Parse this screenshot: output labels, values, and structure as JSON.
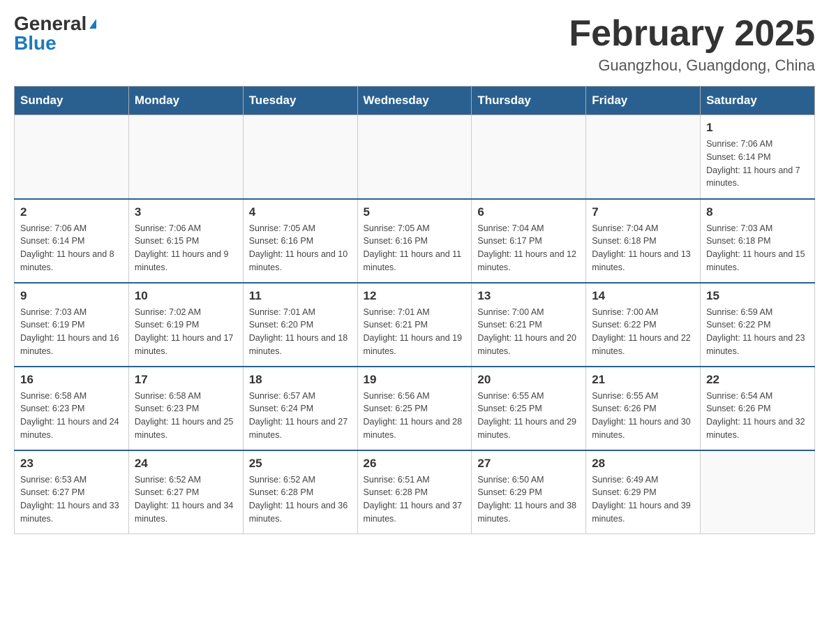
{
  "header": {
    "logo_general": "General",
    "logo_blue": "Blue",
    "month_title": "February 2025",
    "subtitle": "Guangzhou, Guangdong, China"
  },
  "days_of_week": [
    "Sunday",
    "Monday",
    "Tuesday",
    "Wednesday",
    "Thursday",
    "Friday",
    "Saturday"
  ],
  "weeks": [
    [
      {
        "day": "",
        "info": ""
      },
      {
        "day": "",
        "info": ""
      },
      {
        "day": "",
        "info": ""
      },
      {
        "day": "",
        "info": ""
      },
      {
        "day": "",
        "info": ""
      },
      {
        "day": "",
        "info": ""
      },
      {
        "day": "1",
        "info": "Sunrise: 7:06 AM\nSunset: 6:14 PM\nDaylight: 11 hours and 7 minutes."
      }
    ],
    [
      {
        "day": "2",
        "info": "Sunrise: 7:06 AM\nSunset: 6:14 PM\nDaylight: 11 hours and 8 minutes."
      },
      {
        "day": "3",
        "info": "Sunrise: 7:06 AM\nSunset: 6:15 PM\nDaylight: 11 hours and 9 minutes."
      },
      {
        "day": "4",
        "info": "Sunrise: 7:05 AM\nSunset: 6:16 PM\nDaylight: 11 hours and 10 minutes."
      },
      {
        "day": "5",
        "info": "Sunrise: 7:05 AM\nSunset: 6:16 PM\nDaylight: 11 hours and 11 minutes."
      },
      {
        "day": "6",
        "info": "Sunrise: 7:04 AM\nSunset: 6:17 PM\nDaylight: 11 hours and 12 minutes."
      },
      {
        "day": "7",
        "info": "Sunrise: 7:04 AM\nSunset: 6:18 PM\nDaylight: 11 hours and 13 minutes."
      },
      {
        "day": "8",
        "info": "Sunrise: 7:03 AM\nSunset: 6:18 PM\nDaylight: 11 hours and 15 minutes."
      }
    ],
    [
      {
        "day": "9",
        "info": "Sunrise: 7:03 AM\nSunset: 6:19 PM\nDaylight: 11 hours and 16 minutes."
      },
      {
        "day": "10",
        "info": "Sunrise: 7:02 AM\nSunset: 6:19 PM\nDaylight: 11 hours and 17 minutes."
      },
      {
        "day": "11",
        "info": "Sunrise: 7:01 AM\nSunset: 6:20 PM\nDaylight: 11 hours and 18 minutes."
      },
      {
        "day": "12",
        "info": "Sunrise: 7:01 AM\nSunset: 6:21 PM\nDaylight: 11 hours and 19 minutes."
      },
      {
        "day": "13",
        "info": "Sunrise: 7:00 AM\nSunset: 6:21 PM\nDaylight: 11 hours and 20 minutes."
      },
      {
        "day": "14",
        "info": "Sunrise: 7:00 AM\nSunset: 6:22 PM\nDaylight: 11 hours and 22 minutes."
      },
      {
        "day": "15",
        "info": "Sunrise: 6:59 AM\nSunset: 6:22 PM\nDaylight: 11 hours and 23 minutes."
      }
    ],
    [
      {
        "day": "16",
        "info": "Sunrise: 6:58 AM\nSunset: 6:23 PM\nDaylight: 11 hours and 24 minutes."
      },
      {
        "day": "17",
        "info": "Sunrise: 6:58 AM\nSunset: 6:23 PM\nDaylight: 11 hours and 25 minutes."
      },
      {
        "day": "18",
        "info": "Sunrise: 6:57 AM\nSunset: 6:24 PM\nDaylight: 11 hours and 27 minutes."
      },
      {
        "day": "19",
        "info": "Sunrise: 6:56 AM\nSunset: 6:25 PM\nDaylight: 11 hours and 28 minutes."
      },
      {
        "day": "20",
        "info": "Sunrise: 6:55 AM\nSunset: 6:25 PM\nDaylight: 11 hours and 29 minutes."
      },
      {
        "day": "21",
        "info": "Sunrise: 6:55 AM\nSunset: 6:26 PM\nDaylight: 11 hours and 30 minutes."
      },
      {
        "day": "22",
        "info": "Sunrise: 6:54 AM\nSunset: 6:26 PM\nDaylight: 11 hours and 32 minutes."
      }
    ],
    [
      {
        "day": "23",
        "info": "Sunrise: 6:53 AM\nSunset: 6:27 PM\nDaylight: 11 hours and 33 minutes."
      },
      {
        "day": "24",
        "info": "Sunrise: 6:52 AM\nSunset: 6:27 PM\nDaylight: 11 hours and 34 minutes."
      },
      {
        "day": "25",
        "info": "Sunrise: 6:52 AM\nSunset: 6:28 PM\nDaylight: 11 hours and 36 minutes."
      },
      {
        "day": "26",
        "info": "Sunrise: 6:51 AM\nSunset: 6:28 PM\nDaylight: 11 hours and 37 minutes."
      },
      {
        "day": "27",
        "info": "Sunrise: 6:50 AM\nSunset: 6:29 PM\nDaylight: 11 hours and 38 minutes."
      },
      {
        "day": "28",
        "info": "Sunrise: 6:49 AM\nSunset: 6:29 PM\nDaylight: 11 hours and 39 minutes."
      },
      {
        "day": "",
        "info": ""
      }
    ]
  ]
}
